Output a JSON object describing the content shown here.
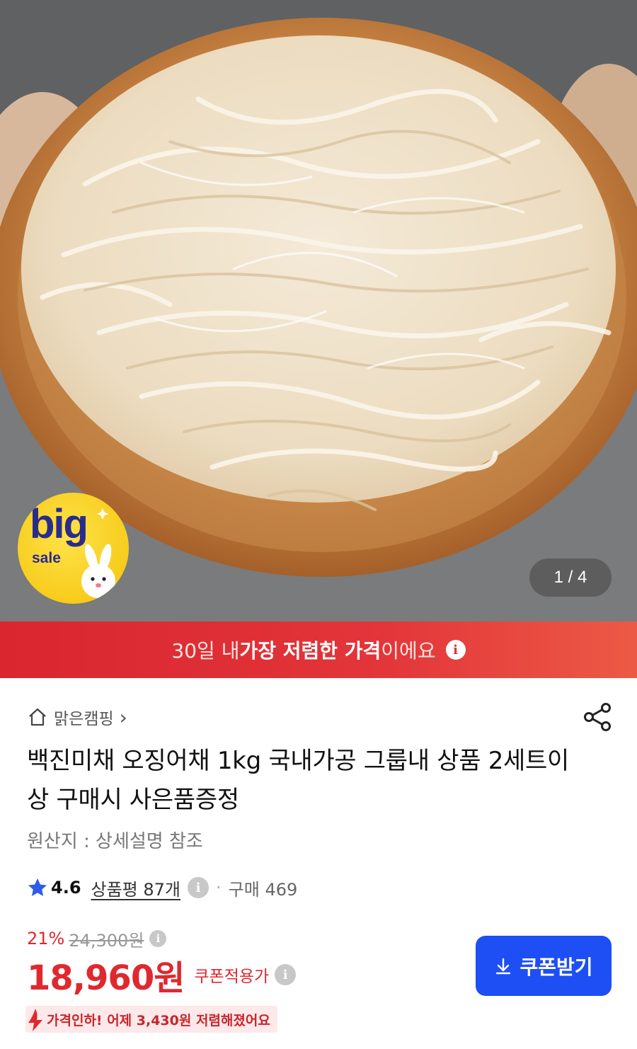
{
  "hero": {
    "image_alt": "",
    "counter": "1 / 4",
    "badge_big": "big",
    "badge_sale": "sale"
  },
  "banner": {
    "part1": "30일 내 ",
    "part2": "가장 저렴한 가격",
    "part3": "이에요",
    "info_icon": "i"
  },
  "store": {
    "icon": "home-icon",
    "name": "맑은캠핑",
    "chevron": "›"
  },
  "product": {
    "title": "백진미채 오징어채 1kg 국내가공 그룹내 상품 2세트이상 구매시 사은품증정",
    "origin": "원산지 : 상세설명 참조"
  },
  "rating": {
    "score": "4.6",
    "reviews": "상품평 87개",
    "separator": "·",
    "purchases": "구매 469"
  },
  "price": {
    "discount_pct": "21%",
    "original_price": "24,300원",
    "sale_price": "18,960원",
    "coupon_label": "쿠폰적용가",
    "coupon_button": "쿠폰받기",
    "price_drop": "가격인하! 어제 3,430원 저렴해졌어요"
  },
  "colors": {
    "accent_red": "#e0282f",
    "coupon_blue": "#1d4ff5",
    "star_blue": "#2f5bea"
  }
}
